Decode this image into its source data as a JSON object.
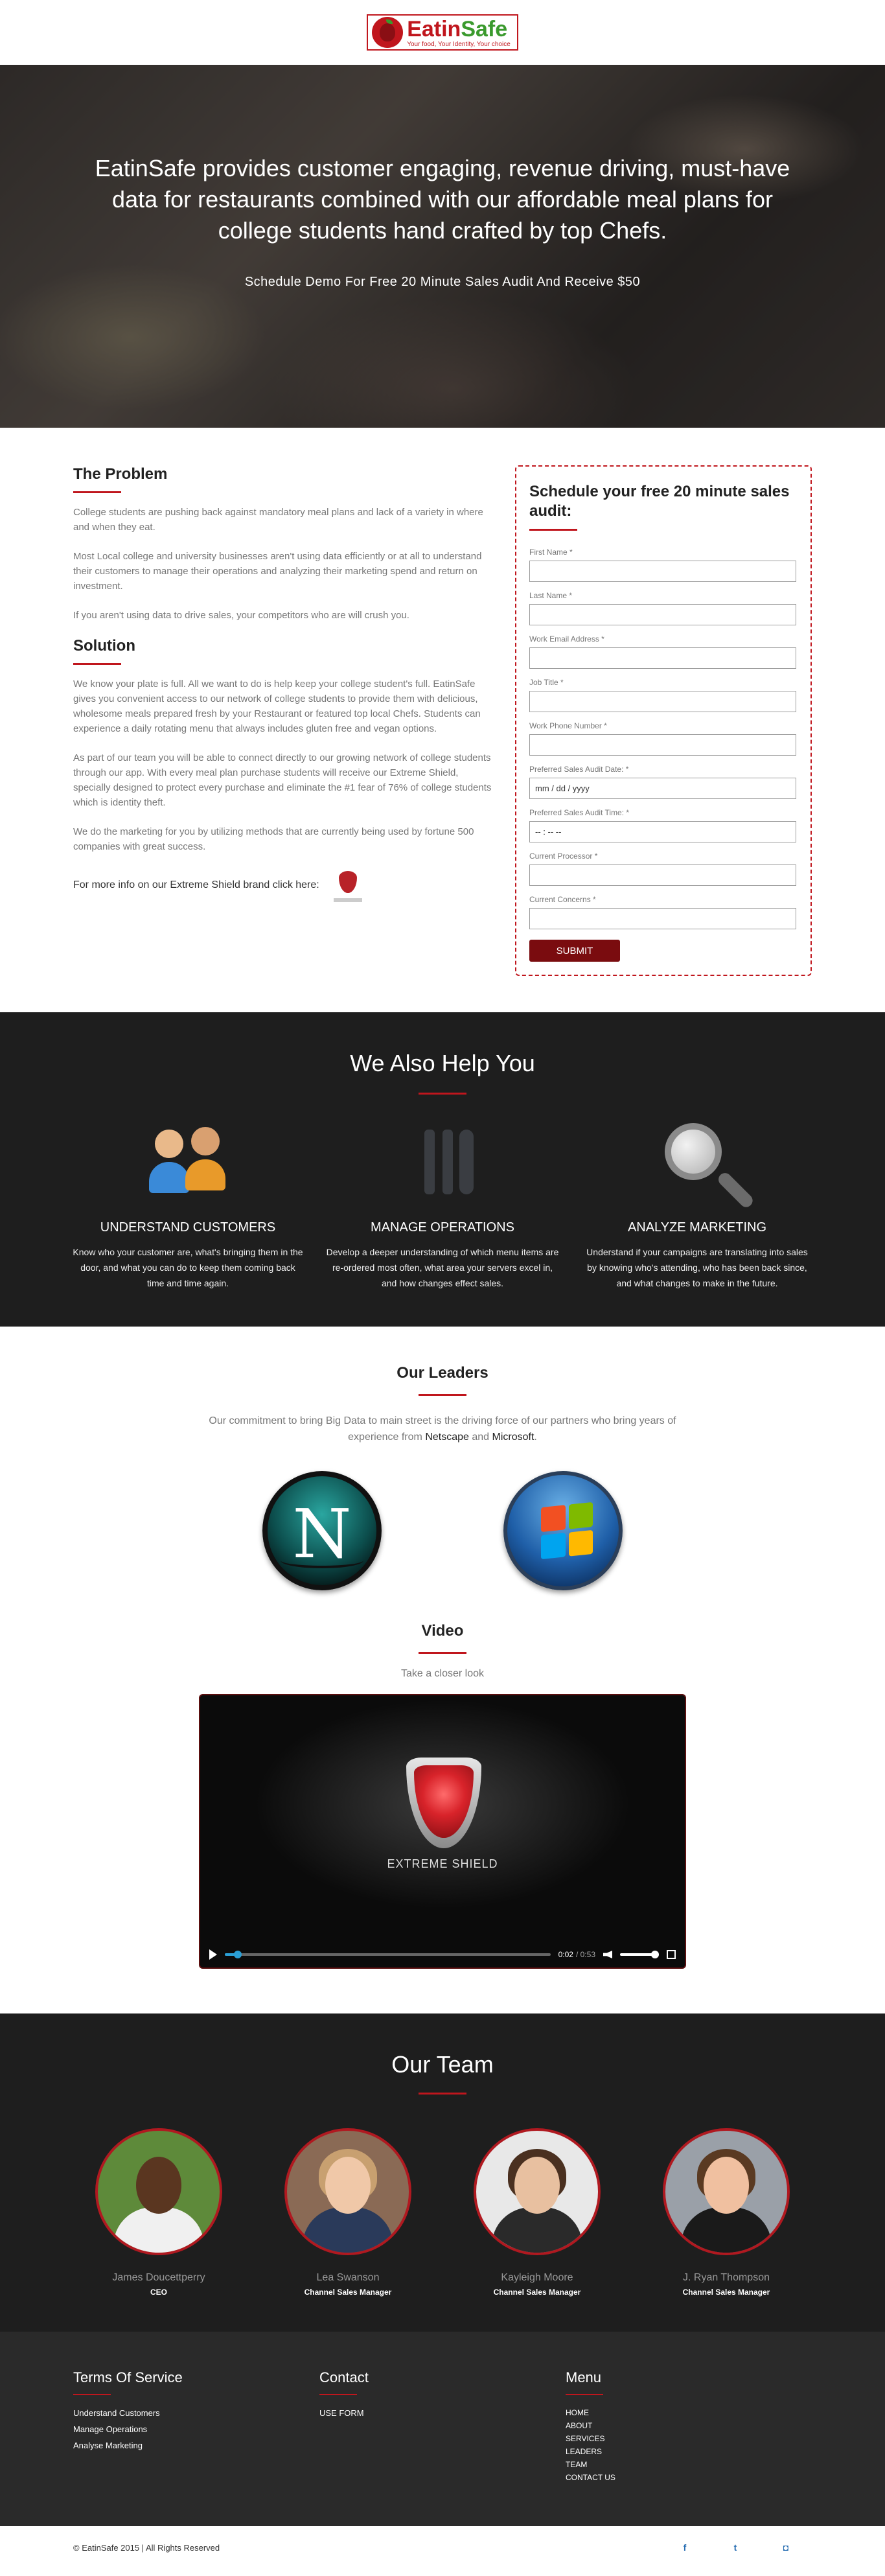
{
  "header": {
    "logo_first": "Eatin",
    "logo_second": "Safe",
    "logo_tagline": "Your food, Your Identity, Your choice"
  },
  "hero": {
    "title": "EatinSafe provides customer engaging, revenue driving, must-have data for restaurants combined with our affordable meal plans for college students hand crafted by top Chefs.",
    "subtitle": "Schedule Demo For Free 20 Minute Sales Audit And Receive $50"
  },
  "problem": {
    "title": "The Problem",
    "p1": "College students are pushing back against mandatory meal plans and lack of a variety in where and when they eat.",
    "p2": "Most Local college and university businesses aren't using data efficiently or at all to understand their customers to manage their operations and analyzing their marketing spend and return on investment.",
    "p3": "If you aren't using data to drive sales, your competitors who are will crush you."
  },
  "solution": {
    "title": "Solution",
    "p1": "We know your plate is full. All we want to do is help keep your college student's full. EatinSafe gives you convenient access to our network of college students to provide them with delicious, wholesome meals prepared fresh by your Restaurant or featured top local Chefs. Students can experience a daily rotating menu that always includes gluten free and vegan options.",
    "p2": "As part of our team you will be able to connect directly to our growing network of college students through our app. With every meal plan purchase students will receive our Extreme Shield, specially designed to protect every purchase and eliminate the #1 fear of 76% of college students which is identity theft.",
    "p3": "We do the marketing for you by utilizing methods that are currently being used by fortune 500 companies with great success.",
    "shield_text": "For more info on our Extreme Shield brand click here:"
  },
  "form": {
    "title": "Schedule your free 20 minute sales audit:",
    "fields": [
      {
        "label": "First Name *",
        "value": ""
      },
      {
        "label": "Last Name *",
        "value": ""
      },
      {
        "label": "Work Email Address *",
        "value": ""
      },
      {
        "label": "Job Title *",
        "value": ""
      },
      {
        "label": "Work Phone Number *",
        "value": ""
      },
      {
        "label": "Preferred Sales Audit Date: *",
        "value": "mm / dd / yyyy"
      },
      {
        "label": "Preferred Sales Audit Time: *",
        "value": "-- : -- --"
      },
      {
        "label": "Current Processor *",
        "value": ""
      },
      {
        "label": "Current Concerns *",
        "value": ""
      }
    ],
    "submit": "SUBMIT"
  },
  "help": {
    "title": "We Also Help You",
    "items": [
      {
        "title": "UNDERSTAND CUSTOMERS",
        "desc": "Know who your customer are, what's bringing them in the door, and what you can do to keep them coming back time and time again."
      },
      {
        "title": "MANAGE OPERATIONS",
        "desc": "Develop a deeper understanding of which menu items are re-ordered most often, what area your servers excel in, and how changes effect sales."
      },
      {
        "title": "ANALYZE MARKETING",
        "desc": "Understand if your campaigns are translating into sales by knowing who's attending, who has been back since, and what changes to make in the future."
      }
    ]
  },
  "leaders": {
    "title": "Our Leaders",
    "text_before": "Our commitment to bring Big Data to main street is the driving force of our partners who bring years of experience from ",
    "netscape": "Netscape",
    "and": " and ",
    "microsoft": "Microsoft",
    "period": "."
  },
  "video": {
    "title": "Video",
    "subtitle": "Take a closer look",
    "overlay_label": "EXTREME SHIELD",
    "current_time": "0:02",
    "duration": "/ 0:53",
    "progress": 0.04
  },
  "team": {
    "title": "Our Team",
    "members": [
      {
        "name": "James Doucettperry",
        "role": "CEO"
      },
      {
        "name": "Lea Swanson",
        "role": "Channel Sales Manager"
      },
      {
        "name": "Kayleigh Moore",
        "role": "Channel Sales Manager"
      },
      {
        "name": "J. Ryan Thompson",
        "role": "Channel Sales Manager"
      }
    ]
  },
  "footer": {
    "terms_title": "Terms Of Service",
    "terms_links": [
      "Understand Customers",
      "Manage Operations",
      "Analyse Marketing"
    ],
    "contact_title": "Contact",
    "contact_links": [
      "USE FORM"
    ],
    "menu_title": "Menu",
    "menu_links": [
      "HOME",
      "ABOUT",
      "SERVICES",
      "LEADERS",
      "TEAM",
      "CONTACT US"
    ],
    "copyright": "© EatinSafe 2015 | All Rights Reserved"
  },
  "colors": {
    "accent": "#c0161d",
    "dark": "#1e1e1e",
    "green": "#3a9a2d"
  },
  "icons": [
    "facebook-icon",
    "twitter-icon",
    "instagram-icon",
    "people-icon",
    "utensils-icon",
    "magnifier-icon"
  ]
}
